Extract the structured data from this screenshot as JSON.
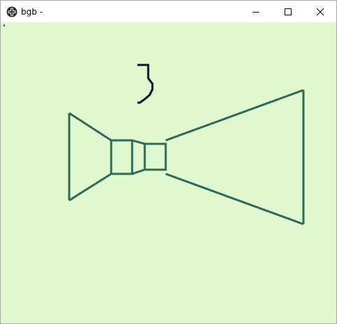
{
  "window": {
    "title": "bgb -",
    "icon": "dpad-cross-icon",
    "controls": [
      "minimize-icon",
      "maximize-icon",
      "close-icon"
    ]
  },
  "screen": {
    "background_color": "#dff8d0",
    "line_color": "#346856",
    "dark_color": "#081820"
  }
}
